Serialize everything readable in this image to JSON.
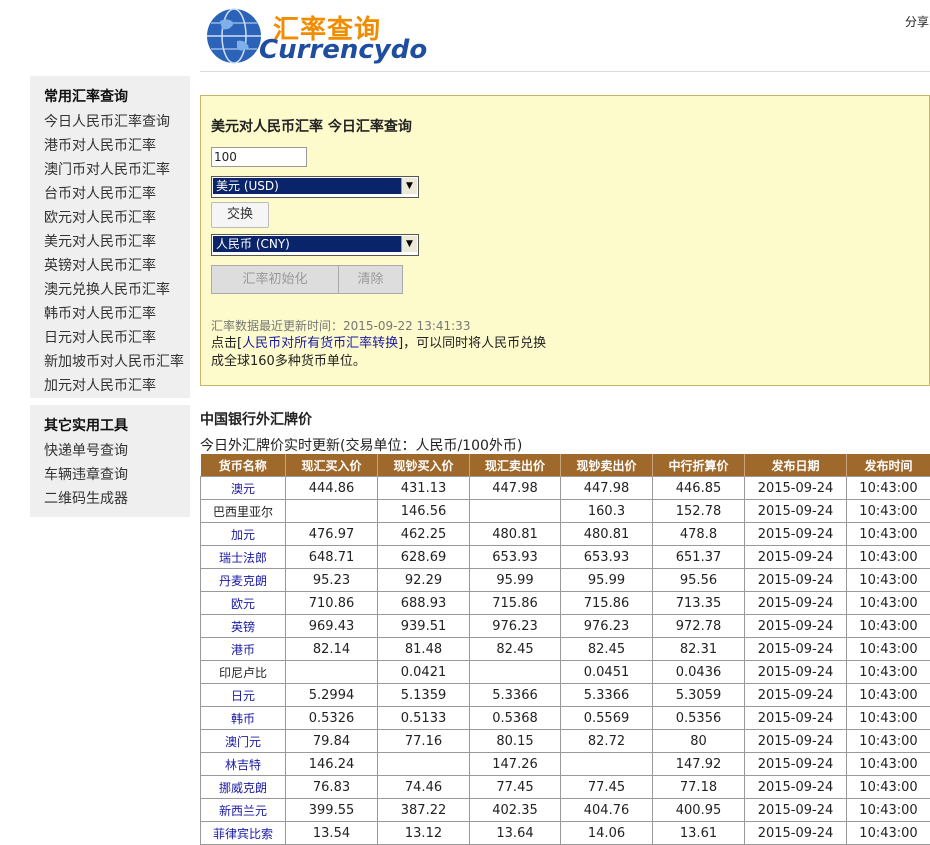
{
  "header": {
    "logo_cn": "汇率查询",
    "logo_en": "Currencydo",
    "share": "分享"
  },
  "sidebar": {
    "common_title": "常用汇率查询",
    "common_items": [
      "今日人民币汇率查询",
      "港币对人民币汇率",
      "澳门币对人民币汇率",
      "台币对人民币汇率",
      "欧元对人民币汇率",
      "美元对人民币汇率",
      "英镑对人民币汇率",
      "澳元兑换人民币汇率",
      "韩币对人民币汇率",
      "日元对人民币汇率",
      "新加坡币对人民币汇率",
      "加元对人民币汇率"
    ],
    "tools_title": "其它实用工具",
    "tools_items": [
      "快递单号查询",
      "车辆违章查询",
      "二维码生成器"
    ]
  },
  "converter": {
    "title": "美元对人民币汇率 今日汇率查询",
    "amount": "100",
    "from_currency": "美元 (USD)",
    "swap_label": "交换",
    "to_currency": "人民币 (CNY)",
    "init_label": "汇率初始化",
    "clear_label": "清除",
    "update_text": "汇率数据最近更新时间：2015-09-22 13:41:33",
    "note_prefix": "点击[",
    "note_link": "人民币对所有货币汇率转换",
    "note_suffix": "]，可以同时将人民币兑换",
    "note_line2": "成全球160多种货币单位。"
  },
  "rates": {
    "title": "中国银行外汇牌价",
    "subtitle": "今日外汇牌价实时更新(交易单位：人民币/100外币)",
    "columns": [
      "货币名称",
      "现汇买入价",
      "现钞买入价",
      "现汇卖出价",
      "现钞卖出价",
      "中行折算价",
      "发布日期",
      "发布时间"
    ],
    "rows": [
      {
        "name": "澳元",
        "link": true,
        "v": [
          "444.86",
          "431.13",
          "447.98",
          "447.98",
          "446.85",
          "2015-09-24",
          "10:43:00"
        ]
      },
      {
        "name": "巴西里亚尔",
        "link": false,
        "v": [
          "",
          "146.56",
          "",
          "160.3",
          "152.78",
          "2015-09-24",
          "10:43:00"
        ]
      },
      {
        "name": "加元",
        "link": true,
        "v": [
          "476.97",
          "462.25",
          "480.81",
          "480.81",
          "478.8",
          "2015-09-24",
          "10:43:00"
        ]
      },
      {
        "name": "瑞士法郎",
        "link": true,
        "v": [
          "648.71",
          "628.69",
          "653.93",
          "653.93",
          "651.37",
          "2015-09-24",
          "10:43:00"
        ]
      },
      {
        "name": "丹麦克朗",
        "link": true,
        "v": [
          "95.23",
          "92.29",
          "95.99",
          "95.99",
          "95.56",
          "2015-09-24",
          "10:43:00"
        ]
      },
      {
        "name": "欧元",
        "link": true,
        "v": [
          "710.86",
          "688.93",
          "715.86",
          "715.86",
          "713.35",
          "2015-09-24",
          "10:43:00"
        ]
      },
      {
        "name": "英镑",
        "link": true,
        "v": [
          "969.43",
          "939.51",
          "976.23",
          "976.23",
          "972.78",
          "2015-09-24",
          "10:43:00"
        ]
      },
      {
        "name": "港币",
        "link": true,
        "v": [
          "82.14",
          "81.48",
          "82.45",
          "82.45",
          "82.31",
          "2015-09-24",
          "10:43:00"
        ]
      },
      {
        "name": "印尼卢比",
        "link": false,
        "v": [
          "",
          "0.0421",
          "",
          "0.0451",
          "0.0436",
          "2015-09-24",
          "10:43:00"
        ]
      },
      {
        "name": "日元",
        "link": true,
        "v": [
          "5.2994",
          "5.1359",
          "5.3366",
          "5.3366",
          "5.3059",
          "2015-09-24",
          "10:43:00"
        ]
      },
      {
        "name": "韩币",
        "link": true,
        "v": [
          "0.5326",
          "0.5133",
          "0.5368",
          "0.5569",
          "0.5356",
          "2015-09-24",
          "10:43:00"
        ]
      },
      {
        "name": "澳门元",
        "link": true,
        "v": [
          "79.84",
          "77.16",
          "80.15",
          "82.72",
          "80",
          "2015-09-24",
          "10:43:00"
        ]
      },
      {
        "name": "林吉特",
        "link": true,
        "v": [
          "146.24",
          "",
          "147.26",
          "",
          "147.92",
          "2015-09-24",
          "10:43:00"
        ]
      },
      {
        "name": "挪威克朗",
        "link": true,
        "v": [
          "76.83",
          "74.46",
          "77.45",
          "77.45",
          "77.18",
          "2015-09-24",
          "10:43:00"
        ]
      },
      {
        "name": "新西兰元",
        "link": true,
        "v": [
          "399.55",
          "387.22",
          "402.35",
          "404.76",
          "400.95",
          "2015-09-24",
          "10:43:00"
        ]
      },
      {
        "name": "菲律宾比索",
        "link": true,
        "v": [
          "13.54",
          "13.12",
          "13.64",
          "14.06",
          "13.61",
          "2015-09-24",
          "10:43:00"
        ]
      }
    ]
  }
}
